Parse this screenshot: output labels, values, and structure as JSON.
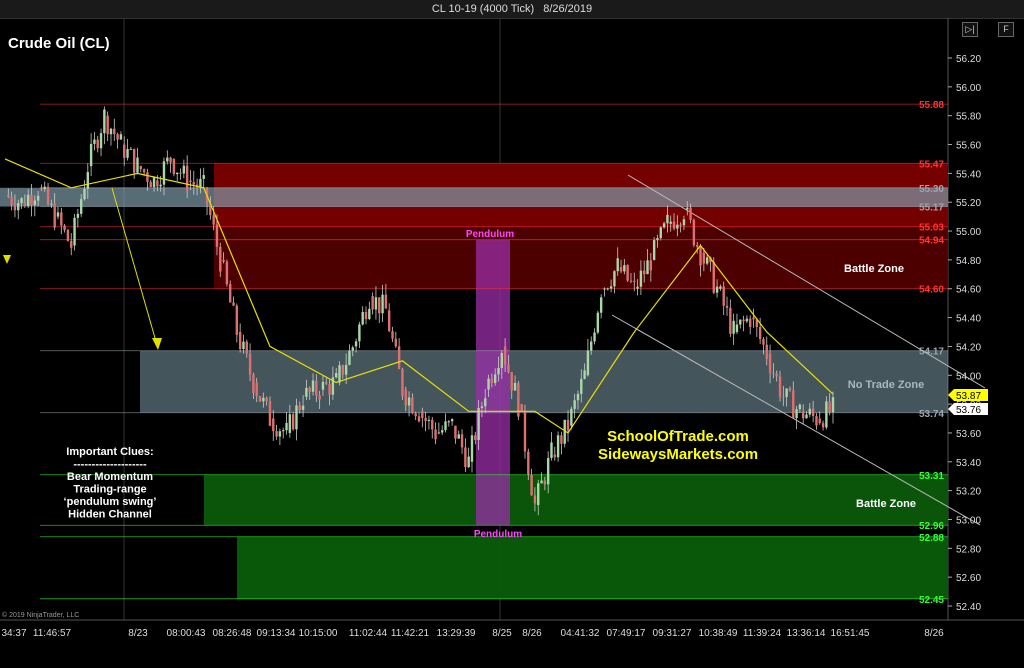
{
  "window": {
    "title_instrument": "CL 10-19 (4000 Tick)",
    "title_date": "8/26/2019",
    "copyright": "© 2019 NinjaTrader, LLC",
    "controls": [
      "▷|",
      "F"
    ]
  },
  "chart_data": {
    "type": "candlestick",
    "title": "Crude Oil (CL)",
    "ylim": [
      52.4,
      56.3
    ],
    "y_ticks": [
      56.2,
      56.0,
      55.8,
      55.6,
      55.4,
      55.2,
      55.0,
      54.8,
      54.6,
      54.4,
      54.2,
      54.0,
      53.8,
      53.6,
      53.4,
      53.2,
      53.0,
      52.8,
      52.6,
      52.4
    ],
    "x_tick_labels": [
      "34:37",
      "11:46:57",
      "8/23",
      "08:00:43",
      "08:26:48",
      "09:13:34",
      "10:15:00",
      "11:02:44",
      "11:42:21",
      "13:29:39",
      "8/25",
      "8/26",
      "04:41:32",
      "07:49:17",
      "09:31:27",
      "10:38:49",
      "11:39:24",
      "13:36:14",
      "16:51:45",
      "8/26"
    ],
    "price_levels": [
      {
        "value": 55.88,
        "label": "55.88",
        "color": "#ff3333"
      },
      {
        "value": 55.47,
        "label": "55.47",
        "color": "#ff3333"
      },
      {
        "value": 55.3,
        "label": "55.30",
        "color": "#9aa7b0"
      },
      {
        "value": 55.17,
        "label": "55.17",
        "color": "#9aa7b0"
      },
      {
        "value": 55.03,
        "label": "55.03",
        "color": "#ff3333"
      },
      {
        "value": 54.94,
        "label": "54.94",
        "color": "#ff3333"
      },
      {
        "value": 54.6,
        "label": "54.60",
        "color": "#ff3333"
      },
      {
        "value": 54.17,
        "label": "54.17",
        "color": "#9aa7b0"
      },
      {
        "value": 53.74,
        "label": "53.74",
        "color": "#9aa7b0"
      },
      {
        "value": 53.31,
        "label": "53.31",
        "color": "#33ff33"
      },
      {
        "value": 52.96,
        "label": "52.96",
        "color": "#33ff33"
      },
      {
        "value": 52.88,
        "label": "52.88",
        "color": "#33ff33"
      },
      {
        "value": 52.45,
        "label": "52.45",
        "color": "#33ff33"
      }
    ],
    "current_prices": [
      {
        "value": 53.87,
        "label": "53.87",
        "color": "#ffff00"
      },
      {
        "value": 53.76,
        "label": "53.76",
        "color": "#ffffff"
      }
    ],
    "zones": [
      {
        "name": "Battle Zone",
        "kind": "resistance",
        "top": 55.47,
        "bottom": 54.6,
        "color": "#8b0000"
      },
      {
        "name": "No Trade Zone",
        "kind": "range",
        "top": 54.17,
        "bottom": 53.74,
        "color": "#7e9aa8"
      },
      {
        "name": "Battle Zone",
        "kind": "support",
        "top": 53.31,
        "bottom": 52.45,
        "color": "#0f6b0f"
      }
    ],
    "annotations": {
      "pendulum_top": "Pendulum",
      "pendulum_bottom": "Pendulum",
      "battle_zone_top": "Battle Zone",
      "no_trade_zone": "No Trade Zone",
      "battle_zone_bottom": "Battle Zone",
      "clues": [
        "Important Clues:",
        "--------------------",
        "Bear Momentum",
        "Trading-range",
        "‘pendulum swing’",
        "Hidden Channel"
      ],
      "website_1": "SchoolOfTrade.com",
      "website_2": "SidewaysMarkets.com"
    },
    "close_path": [
      [
        0,
        55.25
      ],
      [
        1,
        55.2
      ],
      [
        2,
        55.3
      ],
      [
        3,
        55.1
      ],
      [
        4,
        54.9
      ],
      [
        5,
        55.45
      ],
      [
        6,
        55.8
      ],
      [
        7,
        55.6
      ],
      [
        8,
        55.45
      ],
      [
        9,
        55.35
      ],
      [
        10,
        55.5
      ],
      [
        11,
        55.35
      ],
      [
        12,
        55.3
      ],
      [
        13,
        54.8
      ],
      [
        14,
        54.3
      ],
      [
        15,
        53.95
      ],
      [
        16,
        53.7
      ],
      [
        17,
        53.6
      ],
      [
        18,
        53.85
      ],
      [
        19,
        53.9
      ],
      [
        20,
        53.95
      ],
      [
        21,
        54.2
      ],
      [
        22,
        54.55
      ],
      [
        23,
        54.45
      ],
      [
        24,
        53.9
      ],
      [
        25,
        53.75
      ],
      [
        26,
        53.6
      ],
      [
        27,
        53.65
      ],
      [
        28,
        53.4
      ],
      [
        29,
        53.9
      ],
      [
        30,
        54.2
      ],
      [
        31,
        53.8
      ],
      [
        32,
        53.1
      ],
      [
        33,
        53.45
      ],
      [
        34,
        53.65
      ],
      [
        35,
        54.0
      ],
      [
        36,
        54.6
      ],
      [
        37,
        54.75
      ],
      [
        38,
        54.6
      ],
      [
        39,
        54.8
      ],
      [
        40,
        55.05
      ],
      [
        41,
        55.15
      ],
      [
        42,
        54.85
      ],
      [
        43,
        54.6
      ],
      [
        44,
        54.3
      ],
      [
        45,
        54.4
      ],
      [
        46,
        54.15
      ],
      [
        47,
        53.85
      ],
      [
        48,
        53.75
      ],
      [
        49,
        53.7
      ],
      [
        50,
        53.76
      ]
    ],
    "sma_path": [
      [
        0,
        55.5
      ],
      [
        4,
        55.3
      ],
      [
        8,
        55.4
      ],
      [
        12,
        55.3
      ],
      [
        16,
        54.2
      ],
      [
        20,
        53.95
      ],
      [
        24,
        54.1
      ],
      [
        28,
        53.75
      ],
      [
        32,
        53.75
      ],
      [
        34,
        53.6
      ],
      [
        38,
        54.3
      ],
      [
        42,
        54.9
      ],
      [
        46,
        54.3
      ],
      [
        50,
        53.87
      ]
    ]
  }
}
